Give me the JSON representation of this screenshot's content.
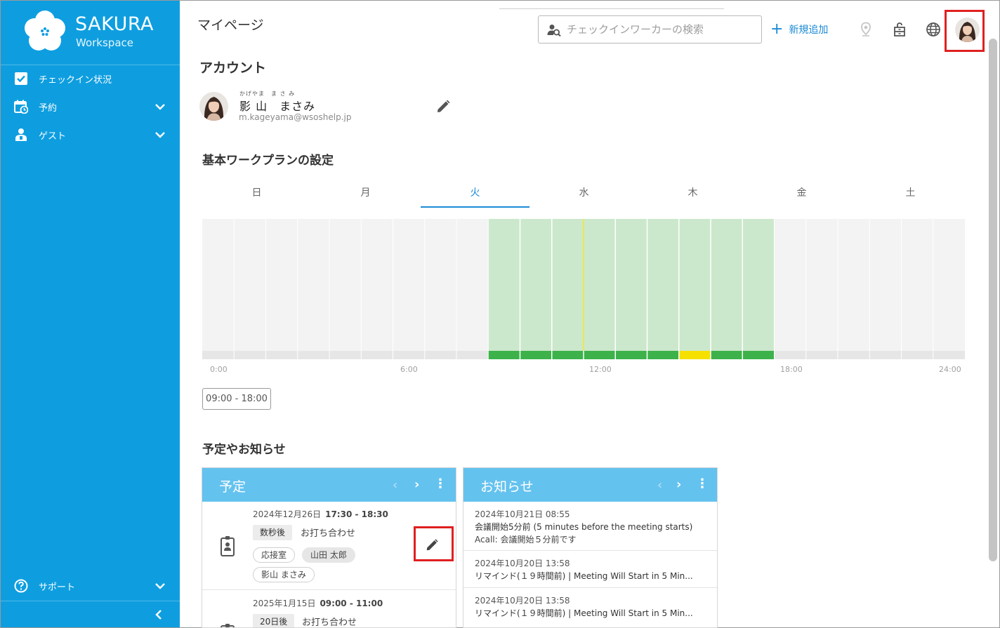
{
  "sidebar": {
    "brand_name": "SAKURA",
    "brand_sub": "Workspace",
    "items": [
      {
        "label": "チェックイン状況",
        "icon": "checkbox-icon"
      },
      {
        "label": "予約",
        "icon": "calendar-clock-icon"
      },
      {
        "label": "ゲスト",
        "icon": "guest-icon"
      }
    ],
    "support_label": "サポート"
  },
  "header": {
    "title": "マイページ",
    "search_placeholder": "チェックインワーカーの検索",
    "add_label": "新規追加",
    "icons": [
      "location-pin-icon",
      "locker-icon",
      "globe-icon",
      "user-avatar"
    ]
  },
  "account": {
    "heading": "アカウント",
    "furigana": "かげやま　ま さ み",
    "name": "影 山　まさみ",
    "email": "m.kageyama@wsoshelp.jp"
  },
  "workplan": {
    "heading": "基本ワークプランの設定",
    "days": [
      "日",
      "月",
      "火",
      "水",
      "木",
      "金",
      "土"
    ],
    "active_day": "火",
    "ticks": [
      "0:00",
      "6:00",
      "12:00",
      "18:00",
      "24:00"
    ],
    "range_label": "09:00 - 18:00",
    "chart_data": {
      "type": "bar",
      "x_range_hours": [
        0,
        24
      ],
      "work_start_hour": 9,
      "work_end_hour": 18,
      "highlight_start_hour": 15,
      "highlight_end_hour": 16,
      "colors": {
        "work_fill": "#cce8cc",
        "work_bar": "#3db24a",
        "highlight_bar": "#f5e000",
        "now_line": "#f0e000",
        "idle": "#f3f3f3"
      }
    }
  },
  "schedule": {
    "heading": "予定やお知らせ",
    "plans_title": "予定",
    "news_title": "お知らせ",
    "events": [
      {
        "date": "2024年12月26日",
        "time": "17:30 - 18:30",
        "badge": "数秒後",
        "title": "お打ち合わせ",
        "chips": [
          "応接室",
          "山田 太郎",
          "影山 まさみ"
        ]
      },
      {
        "date": "2025年1月15日",
        "time": "09:00 - 11:00",
        "badge": "20日後",
        "title": "お打ち合わせ"
      }
    ],
    "news": [
      {
        "date": "2024年10月21日 08:55",
        "line1": "会議開始5分前 (5 minutes before the meeting starts)",
        "line2": "Acall: 会議開始５分前です"
      },
      {
        "date": "2024年10月20日 13:58",
        "line1": "リマインド(１９時間前) | Meeting Will Start in 5 Min..."
      },
      {
        "date": "2024年10月20日 13:58",
        "line1": "リマインド(１９時間前) | Meeting Will Start in 5 Min..."
      }
    ]
  },
  "colors": {
    "sidebar": "#0e9ee0",
    "accent": "#1a8bd6",
    "card_header": "#64c2ef",
    "highlight_box": "#e02020"
  }
}
